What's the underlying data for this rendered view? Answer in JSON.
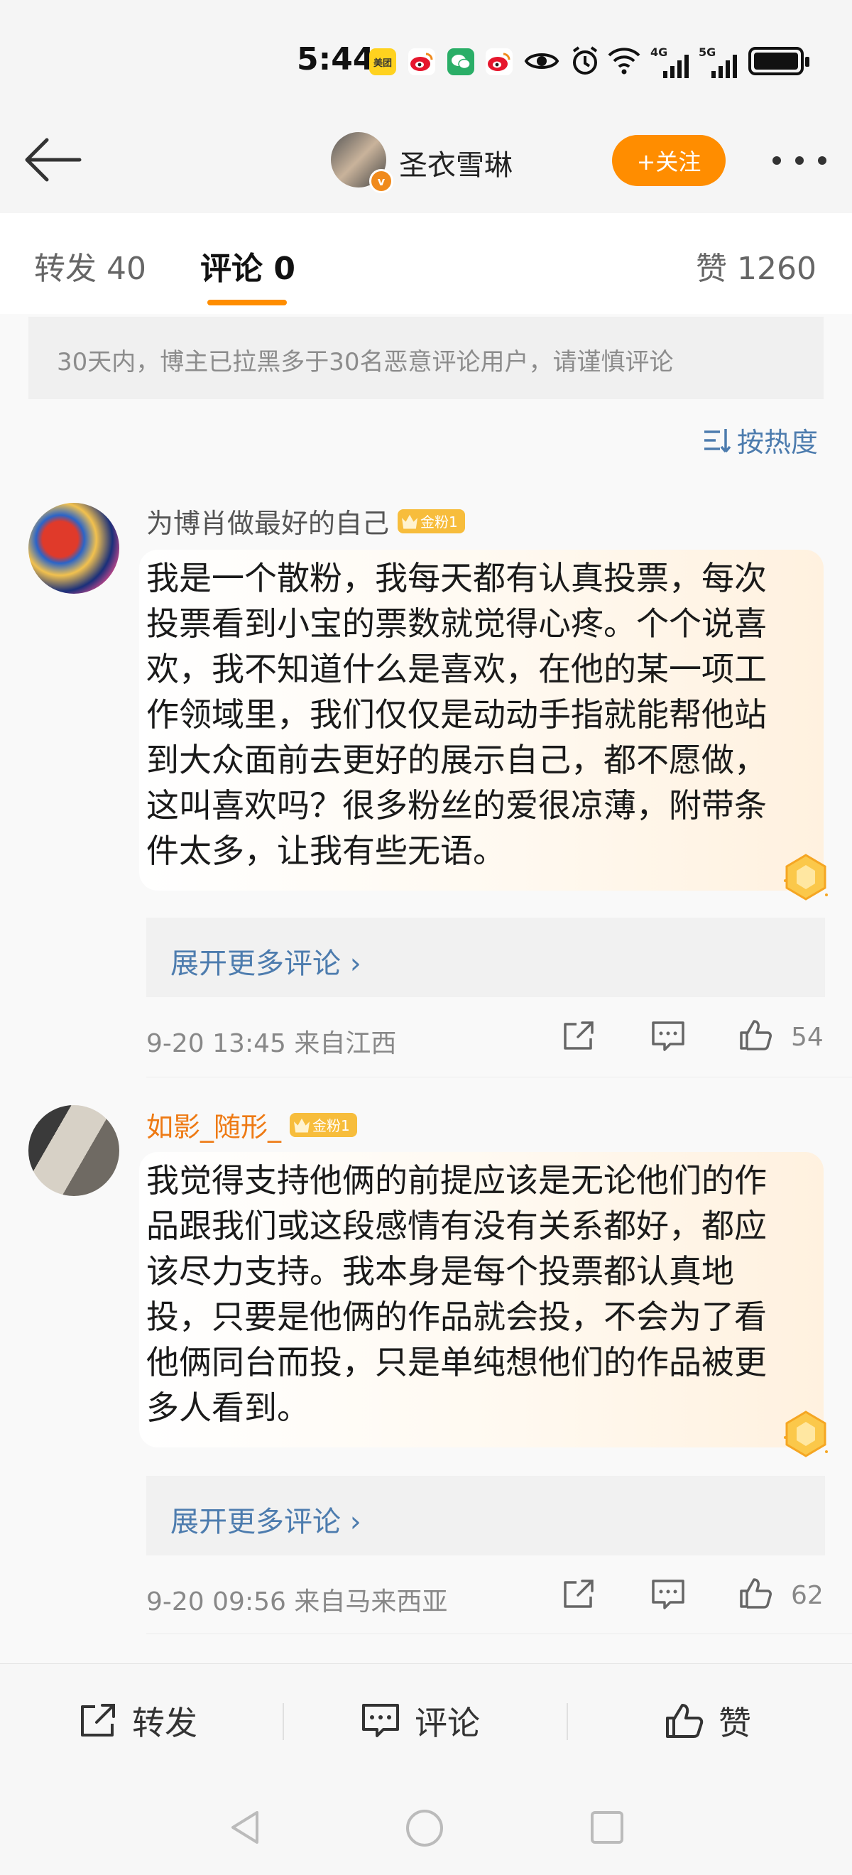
{
  "status_bar": {
    "time": "5:44",
    "app_icons": [
      "meituan-icon",
      "weibo-icon",
      "wechat-icon",
      "weibo-icon"
    ],
    "meituan_label": "美团",
    "signal_labels": [
      "4G",
      "5G"
    ]
  },
  "header": {
    "author_name": "圣衣雪琳",
    "verified_badge": "v",
    "follow_label": "+关注"
  },
  "tabs": {
    "repost": "转发 40",
    "comment": "评论 0",
    "like": "赞 1260"
  },
  "notice": "30天内，博主已拉黑多于30名恶意评论用户，请谨慎评论",
  "sort_label": "按热度",
  "comments": [
    {
      "username": "为博肖做最好的自己",
      "fan_badge": "金粉1",
      "text": "我是一个散粉，我每天都有认真投票，每次投票看到小宝的票数就觉得心疼。个个说喜欢，我不知道什么是喜欢，在他的某一项工作领域里，我们仅仅是动动手指就能帮他站到大众面前去更好的展示自己，都不愿做，这叫喜欢吗？很多粉丝的爱很凉薄，附带条件太多，让我有些无语。",
      "expand_label": "展开更多评论 ›",
      "meta": "9-20 13:45  来自江西",
      "likes": "54"
    },
    {
      "username": "如影_随形_",
      "fan_badge": "金粉1",
      "text": "我觉得支持他俩的前提应该是无论他们的作品跟我们或这段感情有没有关系都好，都应该尽力支持。我本身是每个投票都认真地投，只要是他俩的作品就会投，不会为了看他俩同台而投，只是单纯想他们的作品被更多人看到。",
      "expand_label": "展开更多评论 ›",
      "meta": "9-20 09:56  来自马来西亚",
      "likes": "62"
    }
  ],
  "bottom_bar": {
    "repost": "转发",
    "comment": "评论",
    "like": "赞"
  },
  "colors": {
    "accent": "#ff8d00",
    "link": "#4d7cae",
    "fan_badge": "#f7bd3c",
    "orange_username": "#ee7a14"
  }
}
